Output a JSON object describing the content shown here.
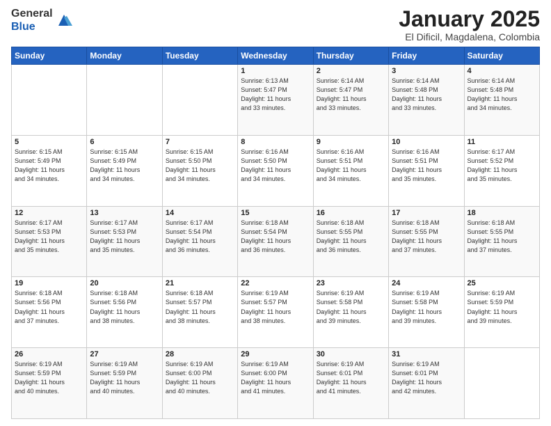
{
  "header": {
    "logo_general": "General",
    "logo_blue": "Blue",
    "month_title": "January 2025",
    "location": "El Dificil, Magdalena, Colombia"
  },
  "weekdays": [
    "Sunday",
    "Monday",
    "Tuesday",
    "Wednesday",
    "Thursday",
    "Friday",
    "Saturday"
  ],
  "weeks": [
    [
      {
        "day": "",
        "info": ""
      },
      {
        "day": "",
        "info": ""
      },
      {
        "day": "",
        "info": ""
      },
      {
        "day": "1",
        "info": "Sunrise: 6:13 AM\nSunset: 5:47 PM\nDaylight: 11 hours\nand 33 minutes."
      },
      {
        "day": "2",
        "info": "Sunrise: 6:14 AM\nSunset: 5:47 PM\nDaylight: 11 hours\nand 33 minutes."
      },
      {
        "day": "3",
        "info": "Sunrise: 6:14 AM\nSunset: 5:48 PM\nDaylight: 11 hours\nand 33 minutes."
      },
      {
        "day": "4",
        "info": "Sunrise: 6:14 AM\nSunset: 5:48 PM\nDaylight: 11 hours\nand 34 minutes."
      }
    ],
    [
      {
        "day": "5",
        "info": "Sunrise: 6:15 AM\nSunset: 5:49 PM\nDaylight: 11 hours\nand 34 minutes."
      },
      {
        "day": "6",
        "info": "Sunrise: 6:15 AM\nSunset: 5:49 PM\nDaylight: 11 hours\nand 34 minutes."
      },
      {
        "day": "7",
        "info": "Sunrise: 6:15 AM\nSunset: 5:50 PM\nDaylight: 11 hours\nand 34 minutes."
      },
      {
        "day": "8",
        "info": "Sunrise: 6:16 AM\nSunset: 5:50 PM\nDaylight: 11 hours\nand 34 minutes."
      },
      {
        "day": "9",
        "info": "Sunrise: 6:16 AM\nSunset: 5:51 PM\nDaylight: 11 hours\nand 34 minutes."
      },
      {
        "day": "10",
        "info": "Sunrise: 6:16 AM\nSunset: 5:51 PM\nDaylight: 11 hours\nand 35 minutes."
      },
      {
        "day": "11",
        "info": "Sunrise: 6:17 AM\nSunset: 5:52 PM\nDaylight: 11 hours\nand 35 minutes."
      }
    ],
    [
      {
        "day": "12",
        "info": "Sunrise: 6:17 AM\nSunset: 5:53 PM\nDaylight: 11 hours\nand 35 minutes."
      },
      {
        "day": "13",
        "info": "Sunrise: 6:17 AM\nSunset: 5:53 PM\nDaylight: 11 hours\nand 35 minutes."
      },
      {
        "day": "14",
        "info": "Sunrise: 6:17 AM\nSunset: 5:54 PM\nDaylight: 11 hours\nand 36 minutes."
      },
      {
        "day": "15",
        "info": "Sunrise: 6:18 AM\nSunset: 5:54 PM\nDaylight: 11 hours\nand 36 minutes."
      },
      {
        "day": "16",
        "info": "Sunrise: 6:18 AM\nSunset: 5:55 PM\nDaylight: 11 hours\nand 36 minutes."
      },
      {
        "day": "17",
        "info": "Sunrise: 6:18 AM\nSunset: 5:55 PM\nDaylight: 11 hours\nand 37 minutes."
      },
      {
        "day": "18",
        "info": "Sunrise: 6:18 AM\nSunset: 5:55 PM\nDaylight: 11 hours\nand 37 minutes."
      }
    ],
    [
      {
        "day": "19",
        "info": "Sunrise: 6:18 AM\nSunset: 5:56 PM\nDaylight: 11 hours\nand 37 minutes."
      },
      {
        "day": "20",
        "info": "Sunrise: 6:18 AM\nSunset: 5:56 PM\nDaylight: 11 hours\nand 38 minutes."
      },
      {
        "day": "21",
        "info": "Sunrise: 6:18 AM\nSunset: 5:57 PM\nDaylight: 11 hours\nand 38 minutes."
      },
      {
        "day": "22",
        "info": "Sunrise: 6:19 AM\nSunset: 5:57 PM\nDaylight: 11 hours\nand 38 minutes."
      },
      {
        "day": "23",
        "info": "Sunrise: 6:19 AM\nSunset: 5:58 PM\nDaylight: 11 hours\nand 39 minutes."
      },
      {
        "day": "24",
        "info": "Sunrise: 6:19 AM\nSunset: 5:58 PM\nDaylight: 11 hours\nand 39 minutes."
      },
      {
        "day": "25",
        "info": "Sunrise: 6:19 AM\nSunset: 5:59 PM\nDaylight: 11 hours\nand 39 minutes."
      }
    ],
    [
      {
        "day": "26",
        "info": "Sunrise: 6:19 AM\nSunset: 5:59 PM\nDaylight: 11 hours\nand 40 minutes."
      },
      {
        "day": "27",
        "info": "Sunrise: 6:19 AM\nSunset: 5:59 PM\nDaylight: 11 hours\nand 40 minutes."
      },
      {
        "day": "28",
        "info": "Sunrise: 6:19 AM\nSunset: 6:00 PM\nDaylight: 11 hours\nand 40 minutes."
      },
      {
        "day": "29",
        "info": "Sunrise: 6:19 AM\nSunset: 6:00 PM\nDaylight: 11 hours\nand 41 minutes."
      },
      {
        "day": "30",
        "info": "Sunrise: 6:19 AM\nSunset: 6:01 PM\nDaylight: 11 hours\nand 41 minutes."
      },
      {
        "day": "31",
        "info": "Sunrise: 6:19 AM\nSunset: 6:01 PM\nDaylight: 11 hours\nand 42 minutes."
      },
      {
        "day": "",
        "info": ""
      }
    ]
  ]
}
